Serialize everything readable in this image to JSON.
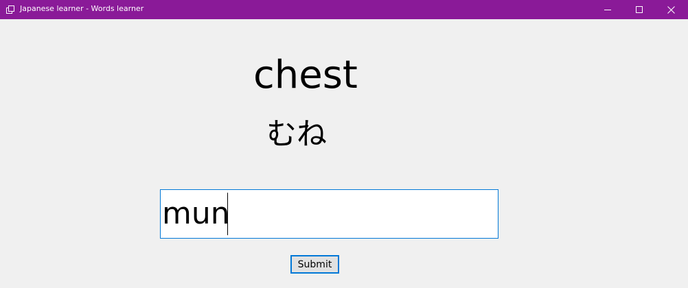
{
  "window": {
    "title": "Japanese learner - Words learner",
    "titlebar_color": "#8a1a98",
    "controls": {
      "minimize_icon": "minimize-icon",
      "maximize_icon": "maximize-icon",
      "close_icon": "close-icon"
    }
  },
  "quiz": {
    "word": "chest",
    "kana": "むね",
    "answer_value": "mun",
    "submit_label": "Submit"
  },
  "colors": {
    "background": "#f0f0f0",
    "focus_border": "#0078d7"
  }
}
